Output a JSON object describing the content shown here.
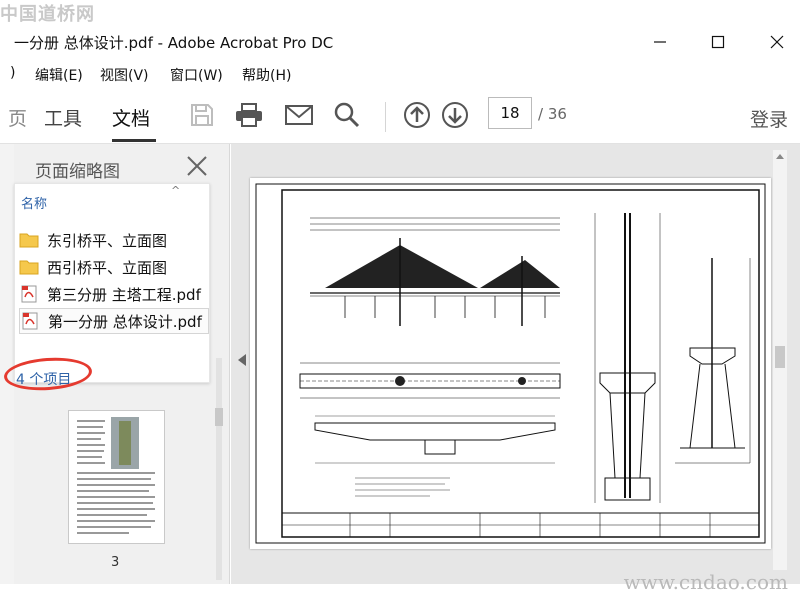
{
  "watermarks": {
    "top_left": "中国道桥网",
    "bottom_right": "www.cndao.com"
  },
  "window": {
    "title": "一分册 总体设计.pdf - Adobe Acrobat Pro DC"
  },
  "menu": {
    "items": [
      "编辑(E)",
      "视图(V)",
      "窗口(W)",
      "帮助(H)"
    ]
  },
  "toolbar": {
    "tabs": [
      "工具",
      "文档"
    ],
    "active_tab": "文档",
    "page_number": "18",
    "page_total": "/ 36",
    "login_label": "登录",
    "icons": [
      "save-icon",
      "print-icon",
      "email-icon",
      "search-icon",
      "arrow-up-icon",
      "arrow-down-icon"
    ]
  },
  "sidebar": {
    "title": "页面缩略图",
    "thumbnail_label": "3"
  },
  "popup": {
    "header": "名称",
    "items": [
      {
        "label": "东引桥平、立面图",
        "type": "folder"
      },
      {
        "label": "西引桥平、立面图",
        "type": "folder"
      },
      {
        "label": "第三分册 主塔工程.pdf",
        "type": "pdf"
      },
      {
        "label": "第一分册 总体设计.pdf",
        "type": "pdf",
        "selected": true
      }
    ],
    "count": "4 个项目"
  },
  "colors": {
    "accent": "#2f63a8",
    "annotation": "#e53a2f"
  }
}
